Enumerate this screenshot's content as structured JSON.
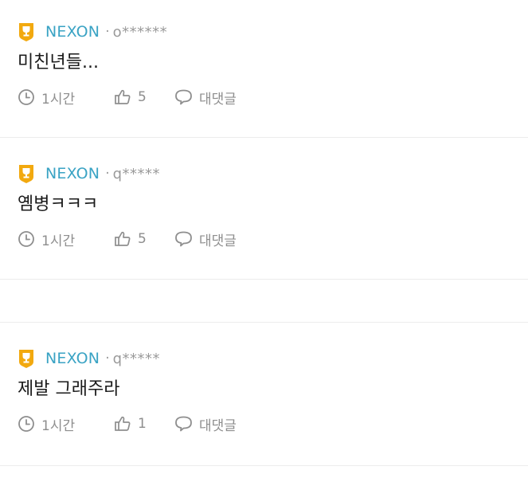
{
  "comments": [
    {
      "nickname": "NEXON",
      "separator": "·",
      "user_id": "o******",
      "text": "미친년들...",
      "time": "1시간",
      "likes": "5",
      "reply_label": "대댓글"
    },
    {
      "nickname": "NEXON",
      "separator": "·",
      "user_id": "q*****",
      "text": "옘병ㅋㅋㅋ",
      "time": "1시간",
      "likes": "5",
      "reply_label": "대댓글"
    },
    {
      "nickname": "NEXON",
      "separator": "·",
      "user_id": "q*****",
      "text": "제발 그래주라",
      "time": "1시간",
      "likes": "1",
      "reply_label": "대댓글"
    }
  ],
  "colors": {
    "badge": "#f2a90f",
    "nickname": "#3aa3c4",
    "muted": "#8e8e8e",
    "divider": "#ececec"
  },
  "icons": {
    "badge": "trophy-badge-icon",
    "time": "clock-icon",
    "like": "thumbs-up-icon",
    "reply": "speech-bubble-icon"
  }
}
